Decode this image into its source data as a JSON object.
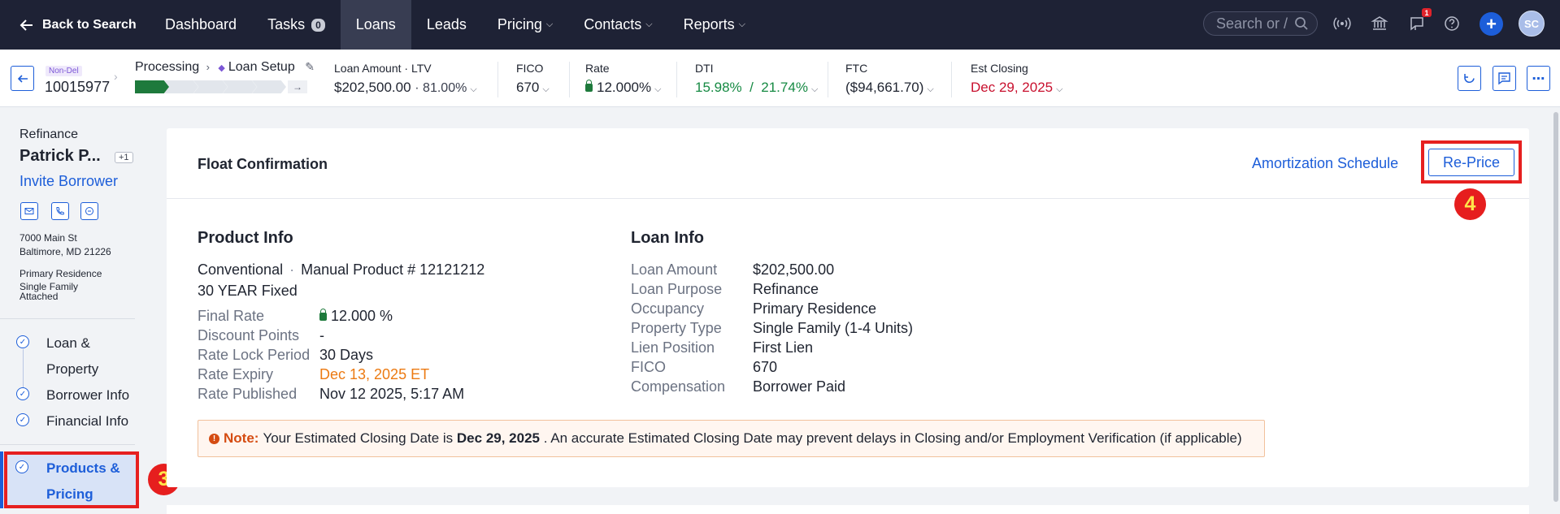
{
  "topnav": {
    "back_label": "Back to Search",
    "items": [
      {
        "label": "Dashboard"
      },
      {
        "label": "Tasks",
        "badge": "0"
      },
      {
        "label": "Loans",
        "active": true
      },
      {
        "label": "Leads"
      },
      {
        "label": "Pricing",
        "dropdown": true
      },
      {
        "label": "Contacts",
        "dropdown": true
      },
      {
        "label": "Reports",
        "dropdown": true
      }
    ],
    "search_placeholder": "Search or /",
    "notification_count": "1",
    "avatar_initials": "SC"
  },
  "loan": {
    "tag": "Non-Del",
    "number": "10015977",
    "stage": "Processing",
    "substage": "Loan Setup",
    "progress_total_steps": 5,
    "progress_done_steps": 1,
    "metrics": {
      "amount_ltv_label": "Loan Amount · LTV",
      "amount": "$202,500.00",
      "ltv": "· 81.00%",
      "fico_label": "FICO",
      "fico": "670",
      "rate_label": "Rate",
      "rate": "12.000%",
      "dti_label": "DTI",
      "dti": "15.98%  /  21.74%",
      "ftc_label": "FTC",
      "ftc": "($94,661.70)",
      "closing_label": "Est Closing",
      "closing": "Dec 29, 2025"
    }
  },
  "sidebar": {
    "loan_type": "Refinance",
    "borrower_name": "Patrick P...",
    "extra_borrowers": "+1",
    "invite_label": "Invite Borrower",
    "address_line1": "7000 Main St",
    "address_line2": "Baltimore, MD 21226",
    "occupancy": "Primary Residence",
    "property_line1": "Single Family",
    "property_line2": "Attached",
    "steps": [
      {
        "line1": "Loan &",
        "line2": "Property"
      },
      {
        "line1": "Borrower Info"
      },
      {
        "line1": "Financial Info"
      },
      {
        "line1": "Products &",
        "line2": "Pricing",
        "active": true
      }
    ]
  },
  "card": {
    "title": "Float Confirmation",
    "amortization_label": "Amortization Schedule",
    "reprice_label": "Re-Price",
    "product": {
      "title": "Product Info",
      "type": "Conventional",
      "manual_product": "Manual Product # 12121212",
      "term": "30 YEAR Fixed",
      "rows": [
        {
          "k": "Final Rate",
          "v": "12.000 %"
        },
        {
          "k": "Discount Points",
          "v": "-"
        },
        {
          "k": "Rate Lock Period",
          "v": "30 Days"
        },
        {
          "k": "Rate Expiry",
          "v": "Dec 13, 2025 ET"
        },
        {
          "k": "Rate Published",
          "v": "Nov 12 2025, 5:17 AM"
        }
      ]
    },
    "loaninfo": {
      "title": "Loan Info",
      "rows": [
        {
          "k": "Loan Amount",
          "v": "$202,500.00"
        },
        {
          "k": "Loan Purpose",
          "v": "Refinance"
        },
        {
          "k": "Occupancy",
          "v": "Primary Residence"
        },
        {
          "k": "Property Type",
          "v": "Single Family (1-4 Units)"
        },
        {
          "k": "Lien Position",
          "v": "First Lien"
        },
        {
          "k": "FICO",
          "v": "670"
        },
        {
          "k": "Compensation",
          "v": "Borrower Paid"
        }
      ]
    },
    "note": {
      "label": "Note:",
      "text_before": "Your Estimated Closing Date is",
      "date": "Dec 29, 2025",
      "text_after": ". An accurate Estimated Closing Date may prevent delays in Closing and/or Employment Verification (if applicable)"
    }
  },
  "markers": {
    "step": "3",
    "reprice": "4"
  },
  "colors": {
    "accent": "#1d5ed9",
    "nav_bg": "#1e2235",
    "success": "#168a43",
    "danger": "#c8102e",
    "warning": "#ec7a12",
    "highlight": "#e62020"
  }
}
